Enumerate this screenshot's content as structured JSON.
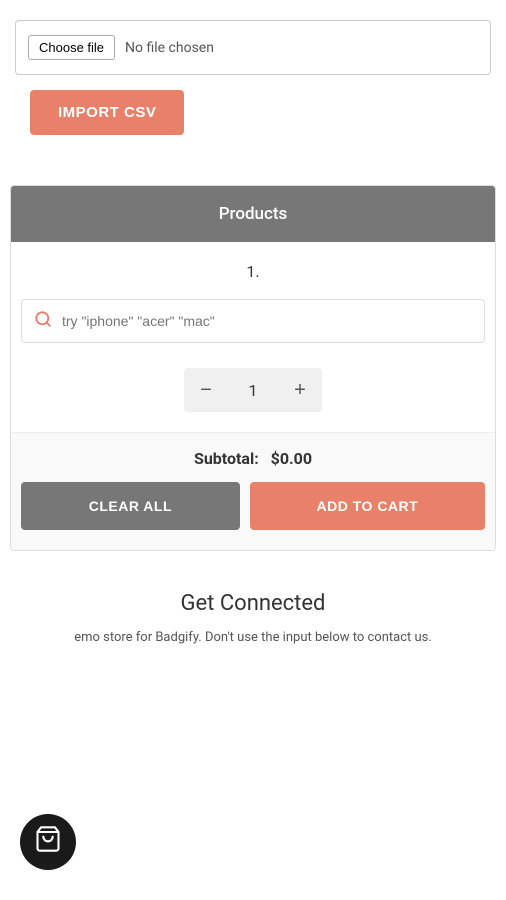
{
  "file_section": {
    "choose_file_label": "Choose file",
    "no_file_label": "No file chosen"
  },
  "import_button": {
    "label": "IMPORT CSV"
  },
  "products_panel": {
    "header": "Products",
    "row_number": "1.",
    "search_placeholder": "try \"iphone\" \"acer\" \"mac\"",
    "quantity": "1",
    "subtotal_label": "Subtotal:",
    "subtotal_value": "$0.00",
    "clear_all_label": "CLEAR ALL",
    "add_to_cart_label": "ADD TO CART"
  },
  "get_connected": {
    "title": "Get Connected",
    "description": "emo store for Badgify. Don't use the input below to contact us."
  },
  "qty_minus": "−",
  "qty_plus": "+",
  "colors": {
    "accent": "#e8806a",
    "header_bg": "#777777",
    "badge_bg": "#1a1a1a"
  }
}
